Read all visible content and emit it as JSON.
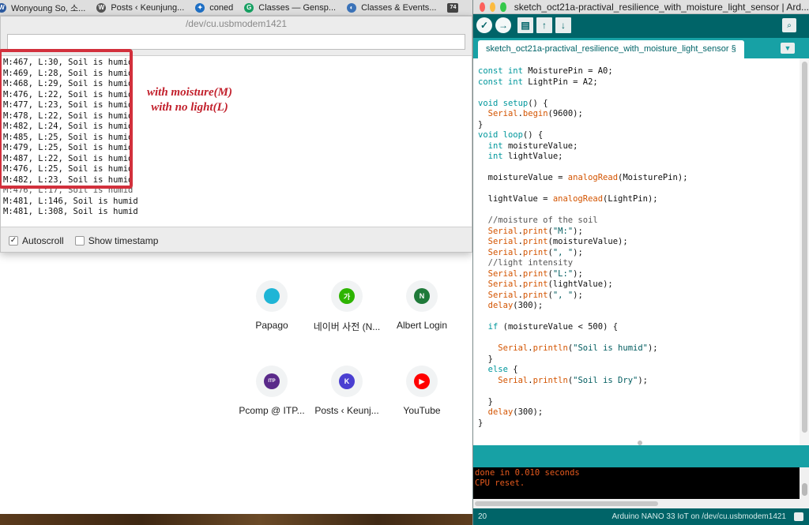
{
  "browser_tabs": [
    {
      "label": "Wonyoung So, 소...",
      "icon": "w-icon"
    },
    {
      "label": "Posts ‹ Keunjung...",
      "icon": "wordpress-icon"
    },
    {
      "label": "coned",
      "icon": "coned-icon"
    },
    {
      "label": "Classes — Gensp...",
      "icon": "g-icon"
    },
    {
      "label": "Classes & Events...",
      "icon": "globe-icon"
    },
    {
      "label": "74",
      "icon": "74-icon"
    }
  ],
  "serial_monitor": {
    "title": "/dev/cu.usbmodem1421",
    "send_value": "",
    "lines": [
      "M:467, L:30, Soil is humid",
      "M:469, L:28, Soil is humid",
      "M:468, L:29, Soil is humid",
      "M:476, L:22, Soil is humid",
      "M:477, L:23, Soil is humid",
      "M:478, L:22, Soil is humid",
      "M:482, L:24, Soil is humid",
      "M:485, L:25, Soil is humid",
      "M:479, L:25, Soil is humid",
      "M:487, L:22, Soil is humid",
      "M:476, L:25, Soil is humid",
      "M:482, L:23, Soil is humid",
      "M:476, L:17, Soil is humid",
      "M:481, L:146, Soil is humid",
      "M:481, L:308, Soil is humid"
    ],
    "annotation_line1": "with moisture(M)",
    "annotation_line2": "with no light(L)",
    "autoscroll_label": "Autoscroll",
    "autoscroll_checked": true,
    "timestamp_label": "Show timestamp",
    "timestamp_checked": false
  },
  "speed_dial": [
    {
      "label": "Papago",
      "icon": "papago-icon",
      "color": "#1fb5d6",
      "glyph": ""
    },
    {
      "label": "네이버 사전 (N...",
      "icon": "naver-dict-icon",
      "color": "#2db400",
      "glyph": "가"
    },
    {
      "label": "Albert Login",
      "icon": "albert-icon",
      "color": "#1f7a3a",
      "glyph": "N"
    },
    {
      "label": "Pcomp @ ITP...",
      "icon": "itp-icon",
      "color": "#5a2a8a",
      "glyph": "ITP"
    },
    {
      "label": "Posts ‹ Keunj...",
      "icon": "k-icon",
      "color": "#4a3fd1",
      "glyph": "K"
    },
    {
      "label": "YouTube",
      "icon": "youtube-icon",
      "color": "#ff0000",
      "glyph": "▶"
    }
  ],
  "ide": {
    "title": "sketch_oct21a-practival_resilience_with_moisture_light_sensor | Ard...",
    "tab_label": "sketch_oct21a-practival_resilience_with_moisture_light_sensor §",
    "code_lines": [
      [
        {
          "c": "kw",
          "t": "const int"
        },
        {
          "c": "",
          "t": " MoisturePin = A0;"
        }
      ],
      [
        {
          "c": "kw",
          "t": "const int"
        },
        {
          "c": "",
          "t": " LightPin = A2;"
        }
      ],
      [],
      [
        {
          "c": "kw",
          "t": "void"
        },
        {
          "c": "",
          "t": " "
        },
        {
          "c": "kw",
          "t": "setup"
        },
        {
          "c": "",
          "t": "() {"
        }
      ],
      [
        {
          "c": "",
          "t": "  "
        },
        {
          "c": "fn",
          "t": "Serial"
        },
        {
          "c": "",
          "t": "."
        },
        {
          "c": "fn",
          "t": "begin"
        },
        {
          "c": "",
          "t": "(9600);"
        }
      ],
      [
        {
          "c": "",
          "t": "}"
        }
      ],
      [
        {
          "c": "kw",
          "t": "void"
        },
        {
          "c": "",
          "t": " "
        },
        {
          "c": "kw",
          "t": "loop"
        },
        {
          "c": "",
          "t": "() {"
        }
      ],
      [
        {
          "c": "",
          "t": "  "
        },
        {
          "c": "kw",
          "t": "int"
        },
        {
          "c": "",
          "t": " moistureValue;"
        }
      ],
      [
        {
          "c": "",
          "t": "  "
        },
        {
          "c": "kw",
          "t": "int"
        },
        {
          "c": "",
          "t": " lightValue;"
        }
      ],
      [],
      [
        {
          "c": "",
          "t": "  moistureValue = "
        },
        {
          "c": "fn",
          "t": "analogRead"
        },
        {
          "c": "",
          "t": "(MoisturePin);"
        }
      ],
      [],
      [
        {
          "c": "",
          "t": "  lightValue = "
        },
        {
          "c": "fn",
          "t": "analogRead"
        },
        {
          "c": "",
          "t": "(LightPin);"
        }
      ],
      [],
      [
        {
          "c": "cm",
          "t": "  //moisture of the soil"
        }
      ],
      [
        {
          "c": "",
          "t": "  "
        },
        {
          "c": "fn",
          "t": "Serial"
        },
        {
          "c": "",
          "t": "."
        },
        {
          "c": "fn",
          "t": "print"
        },
        {
          "c": "",
          "t": "("
        },
        {
          "c": "str",
          "t": "\"M:\""
        },
        {
          "c": "",
          "t": ");"
        }
      ],
      [
        {
          "c": "",
          "t": "  "
        },
        {
          "c": "fn",
          "t": "Serial"
        },
        {
          "c": "",
          "t": "."
        },
        {
          "c": "fn",
          "t": "print"
        },
        {
          "c": "",
          "t": "(moistureValue);"
        }
      ],
      [
        {
          "c": "",
          "t": "  "
        },
        {
          "c": "fn",
          "t": "Serial"
        },
        {
          "c": "",
          "t": "."
        },
        {
          "c": "fn",
          "t": "print"
        },
        {
          "c": "",
          "t": "("
        },
        {
          "c": "str",
          "t": "\", \""
        },
        {
          "c": "",
          "t": ");"
        }
      ],
      [
        {
          "c": "cm",
          "t": "  //light intensity"
        }
      ],
      [
        {
          "c": "",
          "t": "  "
        },
        {
          "c": "fn",
          "t": "Serial"
        },
        {
          "c": "",
          "t": "."
        },
        {
          "c": "fn",
          "t": "print"
        },
        {
          "c": "",
          "t": "("
        },
        {
          "c": "str",
          "t": "\"L:\""
        },
        {
          "c": "",
          "t": ");"
        }
      ],
      [
        {
          "c": "",
          "t": "  "
        },
        {
          "c": "fn",
          "t": "Serial"
        },
        {
          "c": "",
          "t": "."
        },
        {
          "c": "fn",
          "t": "print"
        },
        {
          "c": "",
          "t": "(lightValue);"
        }
      ],
      [
        {
          "c": "",
          "t": "  "
        },
        {
          "c": "fn",
          "t": "Serial"
        },
        {
          "c": "",
          "t": "."
        },
        {
          "c": "fn",
          "t": "print"
        },
        {
          "c": "",
          "t": "("
        },
        {
          "c": "str",
          "t": "\", \""
        },
        {
          "c": "",
          "t": ");"
        }
      ],
      [
        {
          "c": "",
          "t": "  "
        },
        {
          "c": "fn",
          "t": "delay"
        },
        {
          "c": "",
          "t": "(300);"
        }
      ],
      [],
      [
        {
          "c": "",
          "t": "  "
        },
        {
          "c": "kw",
          "t": "if"
        },
        {
          "c": "",
          "t": " (moistureValue < 500) {"
        }
      ],
      [],
      [
        {
          "c": "",
          "t": "    "
        },
        {
          "c": "fn",
          "t": "Serial"
        },
        {
          "c": "",
          "t": "."
        },
        {
          "c": "fn",
          "t": "println"
        },
        {
          "c": "",
          "t": "("
        },
        {
          "c": "str",
          "t": "\"Soil is humid\""
        },
        {
          "c": "",
          "t": ");"
        }
      ],
      [
        {
          "c": "",
          "t": "  }"
        }
      ],
      [
        {
          "c": "",
          "t": "  "
        },
        {
          "c": "kw",
          "t": "else"
        },
        {
          "c": "",
          "t": " {"
        }
      ],
      [
        {
          "c": "",
          "t": "    "
        },
        {
          "c": "fn",
          "t": "Serial"
        },
        {
          "c": "",
          "t": "."
        },
        {
          "c": "fn",
          "t": "println"
        },
        {
          "c": "",
          "t": "("
        },
        {
          "c": "str",
          "t": "\"Soil is Dry\""
        },
        {
          "c": "",
          "t": ");"
        }
      ],
      [],
      [
        {
          "c": "",
          "t": "  }"
        }
      ],
      [
        {
          "c": "",
          "t": "  "
        },
        {
          "c": "fn",
          "t": "delay"
        },
        {
          "c": "",
          "t": "(300);"
        }
      ],
      [
        {
          "c": "",
          "t": "}"
        }
      ]
    ],
    "console_lines": [
      "done in 0.010 seconds",
      "CPU reset."
    ],
    "line_number": "20",
    "board": "Arduino NANO 33 IoT on /dev/cu.usbmodem1421"
  }
}
